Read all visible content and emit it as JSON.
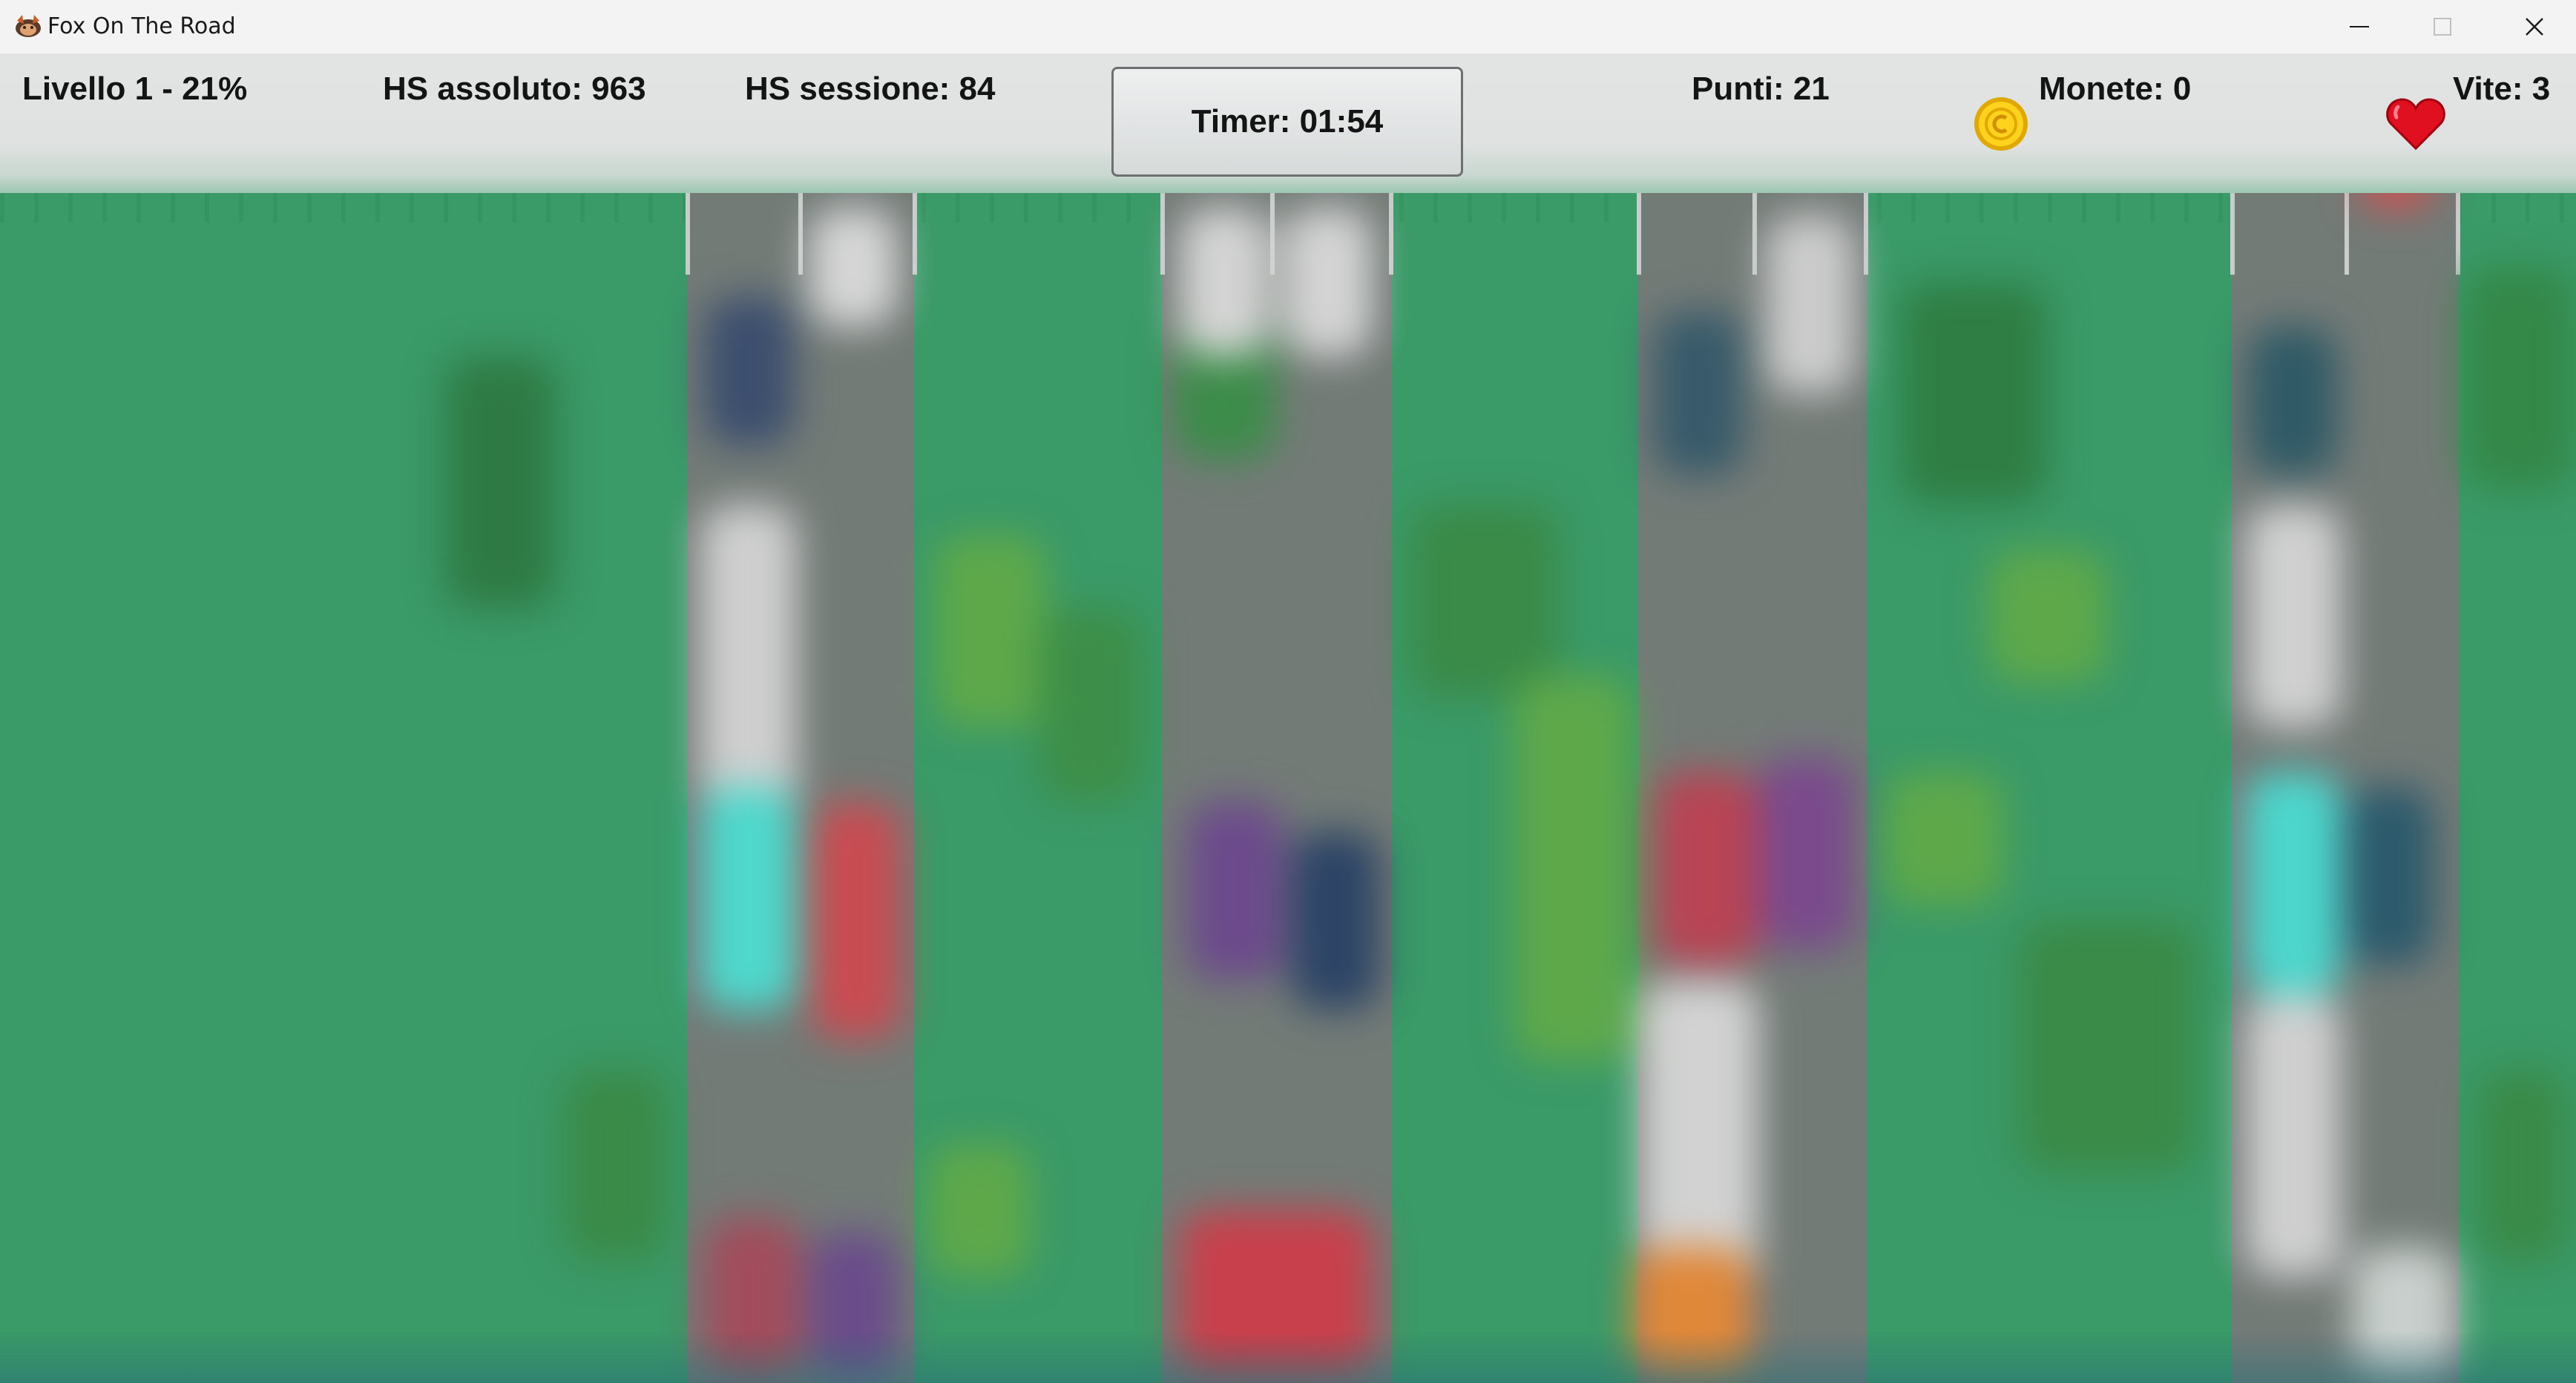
{
  "window": {
    "title": "Fox On The Road"
  },
  "hud": {
    "level": "Livello 1 - 21%",
    "highscore_absolute": "HS assoluto: 963",
    "highscore_session": "HS sessione: 84",
    "timer": "Timer: 01:54",
    "points": "Punti: 21",
    "coins": "Monete: 0",
    "lives": "Vite: 3"
  },
  "icons": {
    "app": "fox-icon",
    "coin": "coin-icon",
    "heart": "heart-icon",
    "minimize": "minimize-icon",
    "maximize": "maximize-icon",
    "close": "close-icon"
  },
  "colors": {
    "grass": "#3a9a68",
    "road": "#737b77",
    "hud_background": "#e0e2e2"
  }
}
